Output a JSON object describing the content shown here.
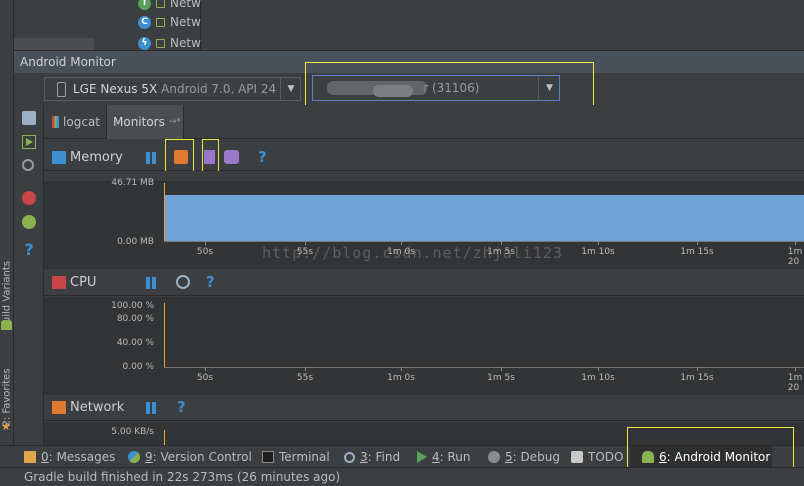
{
  "tree": {
    "items": [
      {
        "badge": "I",
        "badge_color": "#5aa05a",
        "label": "Netw"
      },
      {
        "badge": "C",
        "badge_color": "#3d8fd1",
        "label": "Netw"
      },
      {
        "badge": "ϟ",
        "badge_color": "#3d8fd1",
        "label": "Netw"
      }
    ]
  },
  "window": {
    "title": "Android Monitor"
  },
  "device": {
    "name": "LGE Nexus 5X",
    "detail": "Android 7.0, API 24"
  },
  "process": {
    "label_tail": "r",
    "pid": "(31106)"
  },
  "tabs": {
    "logcat": "logcat",
    "monitors": "Monitors",
    "monitors_suffix": "→*"
  },
  "left_strip": {
    "build_variants": "Build Variants",
    "build_variants_num": "4:",
    "favorites": "2: Favorites"
  },
  "monitors": {
    "memory": {
      "title": "Memory",
      "y_top": "46.71 MB",
      "y_bottom": "0.00 MB",
      "fill_color": "#6fa3d9"
    },
    "cpu": {
      "title": "CPU",
      "y_ticks": [
        "100.00 %",
        "80.00 %",
        "40.00 %",
        "0.00 %"
      ]
    },
    "network": {
      "title": "Network",
      "y_top": "5.00 KB/s"
    },
    "time_ticks": [
      "50s",
      "55s",
      "1m 0s",
      "1m 5s",
      "1m 10s",
      "1m 15s",
      "1m 20"
    ]
  },
  "bottom_tabs": [
    {
      "key": "0",
      "label": ": Messages"
    },
    {
      "key": "9",
      "label": ": Version Control"
    },
    {
      "key": "",
      "label": "Terminal"
    },
    {
      "key": "3",
      "label": ": Find"
    },
    {
      "key": "4",
      "label": ": Run"
    },
    {
      "key": "5",
      "label": ": Debug"
    },
    {
      "key": "",
      "label": "TODO"
    },
    {
      "key": "6",
      "label": ": Android Monitor"
    }
  ],
  "status": {
    "text": "Gradle build finished in 22s 273ms (26 minutes ago)"
  },
  "watermark": "http://blog.csdn.net/zhjali123",
  "colors": {
    "accent": "#3d8fd1",
    "highlight_box": "#f0e83a",
    "memory_fill": "#6fa3d9"
  }
}
